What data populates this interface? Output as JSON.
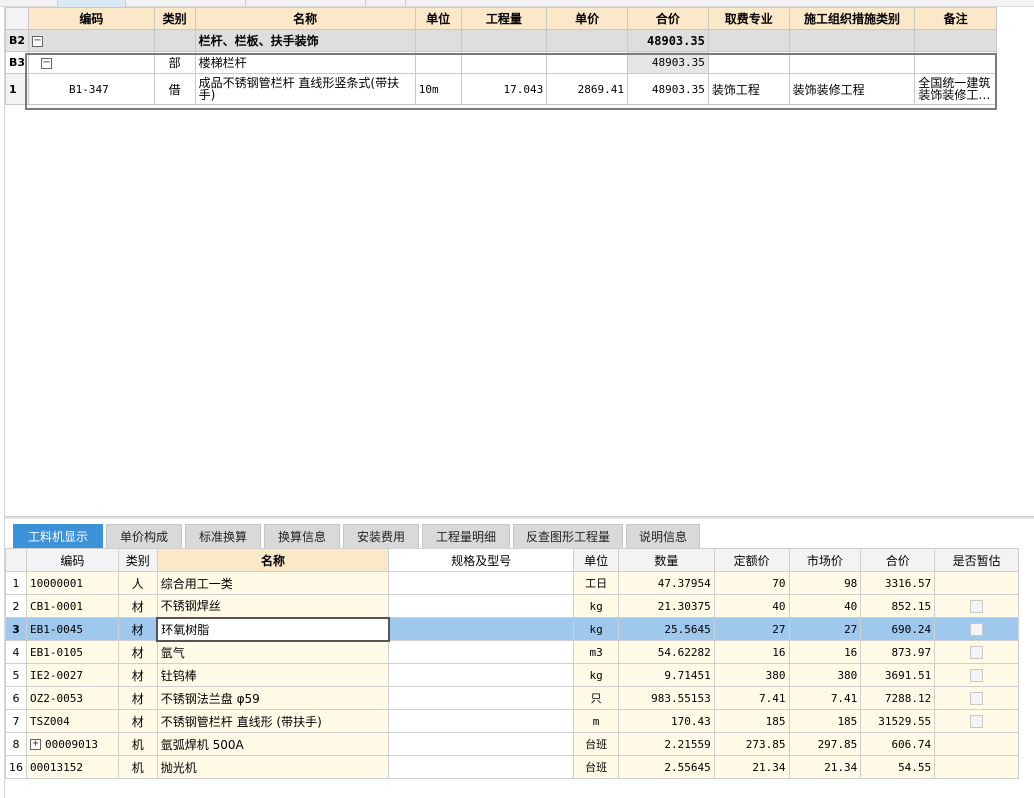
{
  "upper": {
    "headers": [
      "编码",
      "类别",
      "名称",
      "单位",
      "工程量",
      "单价",
      "合价",
      "取费专业",
      "施工组织措施类别",
      "备注"
    ],
    "rows": [
      {
        "row_id": "B2",
        "toggle": "−",
        "code": "",
        "type": "",
        "name": "栏杆、栏板、扶手装饰",
        "unit": "",
        "qty": "",
        "price": "",
        "total": "48903.35",
        "fee": "",
        "measure": "",
        "note": ""
      },
      {
        "row_id": "B3",
        "toggle": "−",
        "code": "",
        "type": "部",
        "name": "楼梯栏杆",
        "unit": "",
        "qty": "",
        "price": "",
        "total": "48903.35",
        "fee": "",
        "measure": "",
        "note": ""
      },
      {
        "row_id": "1",
        "toggle": "",
        "code": "B1-347",
        "type": "借",
        "name": "成品不锈钢管栏杆 直线形竖条式(带扶手)",
        "unit": "10m",
        "qty": "17.043",
        "price": "2869.41",
        "total": "48903.35",
        "fee": "装饰工程",
        "measure": "装饰装修工程",
        "note": "全国统一建筑装饰装修工…"
      }
    ]
  },
  "tabs": [
    "工料机显示",
    "单价构成",
    "标准换算",
    "换算信息",
    "安装费用",
    "工程量明细",
    "反查图形工程量",
    "说明信息"
  ],
  "lower": {
    "headers": [
      "编码",
      "类别",
      "名称",
      "规格及型号",
      "单位",
      "数量",
      "定额价",
      "市场价",
      "合价",
      "是否暂估"
    ],
    "rows": [
      {
        "rn": "1",
        "code": "10000001",
        "type": "人",
        "name": "综合用工一类",
        "spec": "",
        "unit": "工日",
        "qty": "47.37954",
        "quota": "70",
        "market": "98",
        "total": "3316.57",
        "est": false
      },
      {
        "rn": "2",
        "code": "CB1-0001",
        "type": "材",
        "name": "不锈钢焊丝",
        "spec": "",
        "unit": "kg",
        "qty": "21.30375",
        "quota": "40",
        "market": "40",
        "total": "852.15",
        "est": true
      },
      {
        "rn": "3",
        "code": "EB1-0045",
        "type": "材",
        "name": "环氧树脂",
        "spec": "",
        "unit": "kg",
        "qty": "25.5645",
        "quota": "27",
        "market": "27",
        "total": "690.24",
        "est": true
      },
      {
        "rn": "4",
        "code": "EB1-0105",
        "type": "材",
        "name": "氩气",
        "spec": "",
        "unit": "m3",
        "qty": "54.62282",
        "quota": "16",
        "market": "16",
        "total": "873.97",
        "est": true
      },
      {
        "rn": "5",
        "code": "IE2-0027",
        "type": "材",
        "name": "钍钨棒",
        "spec": "",
        "unit": "kg",
        "qty": "9.71451",
        "quota": "380",
        "market": "380",
        "total": "3691.51",
        "est": true
      },
      {
        "rn": "6",
        "code": "OZ2-0053",
        "type": "材",
        "name": "不锈钢法兰盘 φ59",
        "spec": "",
        "unit": "只",
        "qty": "983.55153",
        "quota": "7.41",
        "market": "7.41",
        "total": "7288.12",
        "est": true
      },
      {
        "rn": "7",
        "code": "TSZ004",
        "type": "材",
        "name": "不锈钢管栏杆 直线形 (带扶手)",
        "spec": "",
        "unit": "m",
        "qty": "170.43",
        "quota": "185",
        "market": "185",
        "total": "31529.55",
        "est": true
      },
      {
        "rn": "8",
        "code": "00009013",
        "type": "机",
        "name": "氩弧焊机 500A",
        "spec": "",
        "unit": "台班",
        "qty": "2.21559",
        "quota": "273.85",
        "market": "297.85",
        "total": "606.74",
        "est": false,
        "expand": "+"
      },
      {
        "rn": "16",
        "code": "00013152",
        "type": "机",
        "name": "抛光机",
        "spec": "",
        "unit": "台班",
        "qty": "2.55645",
        "quota": "21.34",
        "market": "21.34",
        "total": "54.55",
        "est": false
      }
    ]
  }
}
